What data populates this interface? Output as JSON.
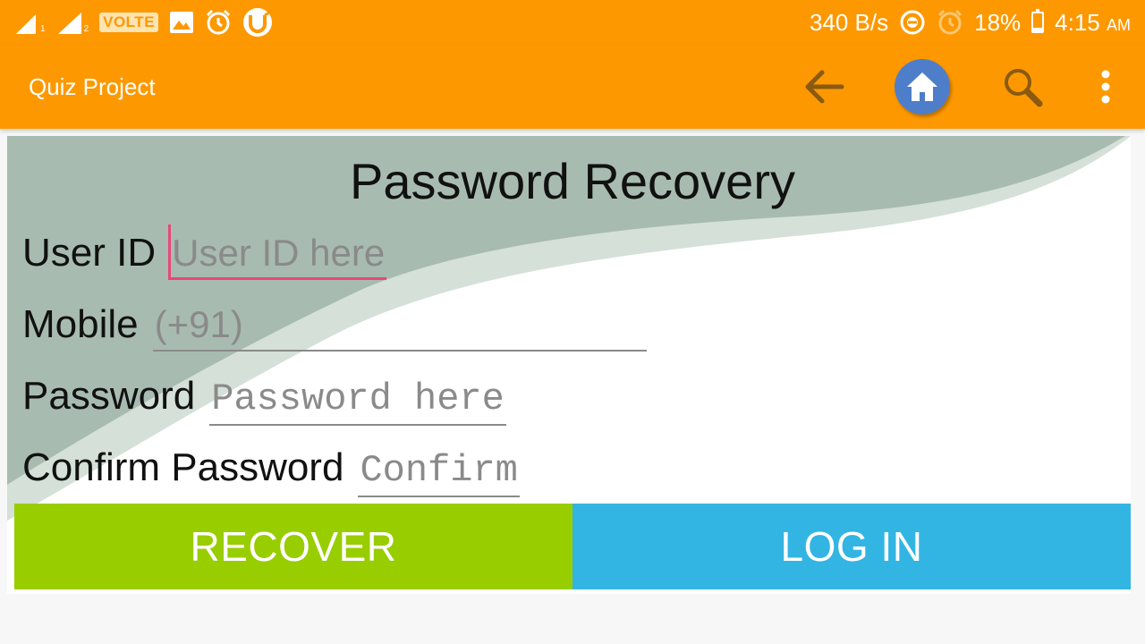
{
  "status_bar": {
    "carrier_badge": "VOLTE",
    "roaming_mark": "R",
    "sim1": "1",
    "sim2": "2",
    "net_speed": "340 B/s",
    "battery_percent": "18%",
    "battery_level": 0.18,
    "time": "4:15",
    "time_suffix": "AM",
    "icons": [
      "signal-icon",
      "signal-roaming-icon",
      "volte-icon",
      "gallery-icon",
      "alarm-icon",
      "utorrent-icon",
      "data-saver-icon",
      "alarm-icon",
      "battery-icon"
    ]
  },
  "app_bar": {
    "title": "Quiz Project",
    "icons": [
      "back-arrow-icon",
      "home-icon",
      "search-icon",
      "overflow-menu-icon"
    ],
    "home_circle_color": "#4e7ec9"
  },
  "form": {
    "heading": "Password Recovery",
    "user_id": {
      "label": "User ID",
      "placeholder": "User ID here"
    },
    "mobile": {
      "label": "Mobile",
      "placeholder": "(+91)"
    },
    "password": {
      "label": "Password",
      "placeholder": "Password here"
    },
    "confirm": {
      "label": "Confirm Password",
      "placeholder": "Confirm"
    }
  },
  "buttons": {
    "recover": "RECOVER",
    "login": "LOG IN"
  },
  "colors": {
    "accent": "#fd9800",
    "recover": "#98cd00",
    "login": "#33b5e3",
    "focus_underline": "#e8467c"
  }
}
